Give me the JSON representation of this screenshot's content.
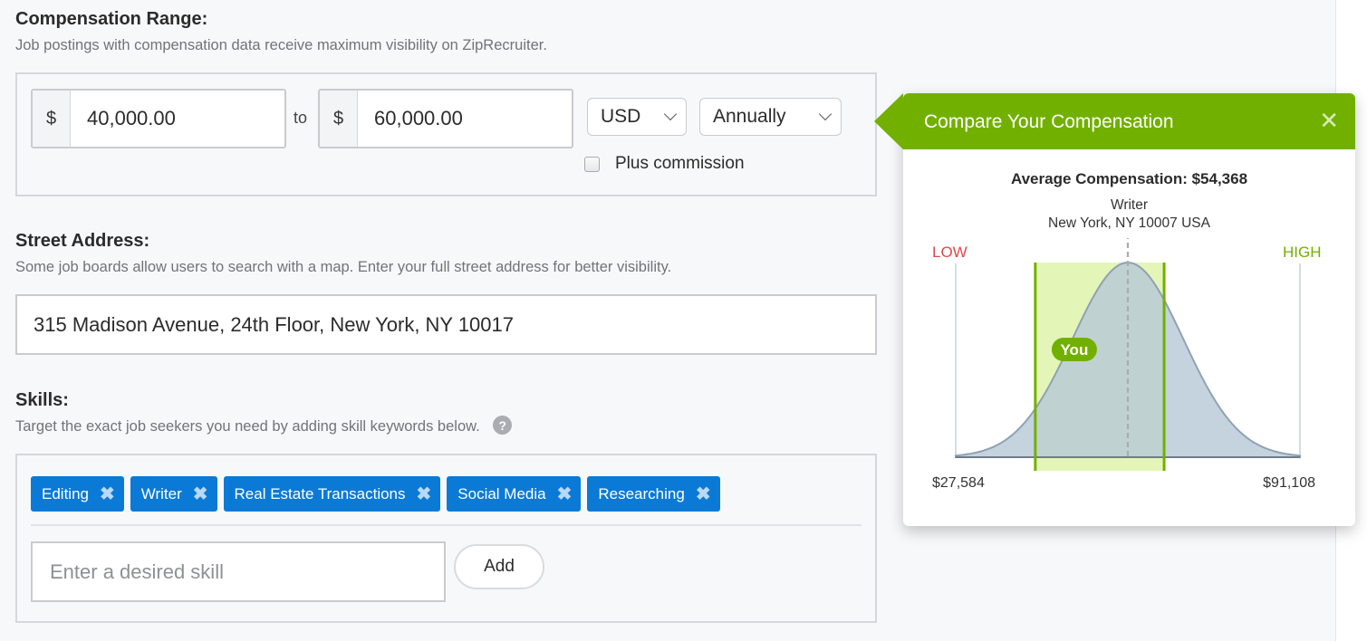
{
  "compensation": {
    "title": "Compensation Range:",
    "help": "Job postings with compensation data receive maximum visibility on ZipRecruiter.",
    "min_prefix": "$",
    "min_value": "40,000.00",
    "to_label": "to",
    "max_prefix": "$",
    "max_value": "60,000.00",
    "currency": "USD",
    "period": "Annually",
    "plus_commission_label": "Plus commission",
    "plus_commission_checked": false
  },
  "address": {
    "title": "Street Address:",
    "help": "Some job boards allow users to search with a map. Enter your full street address for better visibility.",
    "value": "315 Madison Avenue, 24th Floor, New York, NY 10017"
  },
  "skills": {
    "title": "Skills:",
    "help": "Target the exact job seekers you need by adding skill keywords below.",
    "help_icon": "question-circle-icon",
    "tags": [
      {
        "label": "Editing",
        "remove_icon": "close-x-icon"
      },
      {
        "label": "Writer",
        "remove_icon": "close-x-icon"
      },
      {
        "label": "Real Estate Transactions",
        "remove_icon": "close-x-icon"
      },
      {
        "label": "Social Media",
        "remove_icon": "close-x-icon"
      },
      {
        "label": "Researching",
        "remove_icon": "close-x-icon"
      }
    ],
    "input_placeholder": "Enter a desired skill",
    "add_label": "Add"
  },
  "popover": {
    "title": "Compare Your Compensation",
    "close_icon": "close-icon",
    "average_label": "Average Compensation: $54,368",
    "job_title": "Writer",
    "location": "New York, NY 10007 USA",
    "colors": {
      "header": "#72b000",
      "low": "#e0474c",
      "high": "#72b000",
      "curve": "#b8c9d8",
      "band": "#e4f5b8"
    }
  },
  "chart_data": {
    "type": "area",
    "title": "Average Compensation: $54,368",
    "low_label": "LOW",
    "high_label": "HIGH",
    "min_label": "$27,584",
    "max_label": "$91,108",
    "x_min": 27584,
    "x_max": 91108,
    "mean": 54368,
    "you_range": [
      40000,
      60000
    ],
    "you_label": "You",
    "distribution": "normal"
  }
}
